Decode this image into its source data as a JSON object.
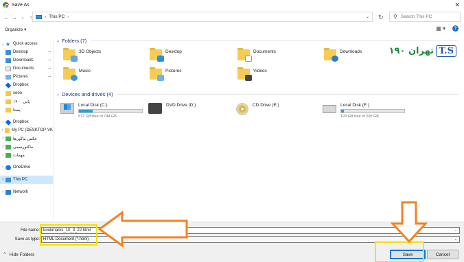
{
  "window": {
    "title": "Save As",
    "close_glyph": "✕"
  },
  "navigation": {
    "back_glyph": "←",
    "forward_glyph": "→",
    "recent_glyph": "⌄",
    "up_glyph": "↑",
    "address_separator": "›",
    "address_location": "This PC",
    "address_dropdown_glyph": "⌄",
    "refresh_glyph": "↻",
    "search_glyph": "⚲",
    "search_placeholder": "Search This PC"
  },
  "toolbar": {
    "organize_label": "Organize ▾",
    "view_glyph": "▦ ▾",
    "help_glyph": "?"
  },
  "sidebar": {
    "items": [
      {
        "label": "Quick access",
        "chev": "⌄",
        "icon": "star-icon"
      },
      {
        "label": "Desktop",
        "icon": "desktop-icon",
        "pin": "📌"
      },
      {
        "label": "Downloads",
        "icon": "downloads-icon",
        "pin": "📌"
      },
      {
        "label": "Documents",
        "icon": "documents-icon",
        "pin": "📌"
      },
      {
        "label": "Pictures",
        "icon": "pictures-icon",
        "pin": "📌"
      },
      {
        "label": "Dropbox",
        "icon": "dropbox-icon"
      },
      {
        "label": "seoo",
        "icon": "folder-icon"
      },
      {
        "label": "پایی ۱۴۰۰",
        "icon": "folder-icon"
      },
      {
        "label": "پستا",
        "icon": "folder-icon"
      },
      {
        "label": "Dropbox",
        "chev": "›",
        "icon": "dropbox-icon"
      },
      {
        "label": "My PC (DESKTOP-VK",
        "chev": "›",
        "icon": "folder-icon"
      },
      {
        "label": "عکس ماکورها",
        "chev": "›",
        "icon": "folder-icon"
      },
      {
        "label": "ماکتورسمی",
        "chev": "›",
        "icon": "folder-icon"
      },
      {
        "label": "مهمات",
        "chev": "›",
        "icon": "folder-icon"
      },
      {
        "label": "OneDrive",
        "chev": "›",
        "icon": "onedrive-icon"
      },
      {
        "label": "This PC",
        "chev": "›",
        "icon": "this-pc-icon"
      },
      {
        "label": "Network",
        "chev": "›",
        "icon": "network-icon"
      }
    ]
  },
  "content": {
    "folders_header": "Folders (7)",
    "drives_header": "Devices and drives (4)",
    "group_chev": "⌄",
    "folders": [
      "3D Objects",
      "Desktop",
      "Documents",
      "Downloads",
      "Music",
      "Pictures",
      "Videos"
    ],
    "drives": [
      {
        "name": "Local Disk (C:)",
        "free": "577 GB free of 744 GB",
        "used_fraction": 0.22
      },
      {
        "name": "DVD Drive (D:)"
      },
      {
        "name": "CD Drive (E:)"
      },
      {
        "name": "Local Disk (F:)",
        "free": "193 GB free of 200 GB",
        "used_fraction": 0.04
      }
    ]
  },
  "watermark": {
    "fa": "تهران ۱۹۰",
    "ts": "T.S"
  },
  "bottom": {
    "file_name_label": "File name:",
    "file_name_value": "bookmarks_10_3_22.html",
    "save_type_label": "Save as type:",
    "save_type_value": "HTML Document (*.html)",
    "dropdown_glyph": "⌄",
    "hide_folders_glyph": "⌃",
    "hide_folders_label": "Hide Folders",
    "save_label": "Save",
    "cancel_label": "Cancel"
  },
  "annotation_colors": {
    "arrow": "#f58220",
    "highlight": "#f5e000"
  }
}
